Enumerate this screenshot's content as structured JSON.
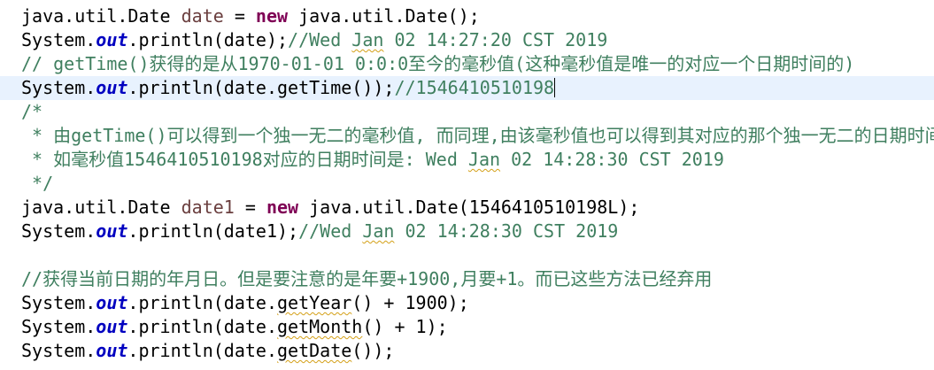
{
  "editor": {
    "current_line_color": "#e8f2fe",
    "colors": {
      "keyword": "#7f0055",
      "variable": "#6a3e3e",
      "static_field": "#0000c0",
      "comment": "#3f7f5f",
      "plain": "#000000"
    },
    "lines": [
      {
        "current": false,
        "tokens": [
          {
            "t": "java.util.Date ",
            "c": "plain"
          },
          {
            "t": "date",
            "c": "var"
          },
          {
            "t": " = ",
            "c": "plain"
          },
          {
            "t": "new",
            "c": "kw"
          },
          {
            "t": " java.util.Date();",
            "c": "plain"
          }
        ]
      },
      {
        "current": false,
        "tokens": [
          {
            "t": "System.",
            "c": "plain"
          },
          {
            "t": "out",
            "c": "static"
          },
          {
            "t": ".println(date);",
            "c": "plain"
          },
          {
            "t": "//Wed ",
            "c": "cmt"
          },
          {
            "t": "Jan",
            "c": "cmt squig"
          },
          {
            "t": " 02 14:27:20 CST 2019",
            "c": "cmt"
          }
        ]
      },
      {
        "current": false,
        "tokens": [
          {
            "t": "// getTime()获得的是从1970-01-01 0:0:0至今的毫秒值(这种毫秒值是唯一的对应一个日期时间的)",
            "c": "cmt"
          }
        ]
      },
      {
        "current": true,
        "tokens": [
          {
            "t": "System.",
            "c": "plain"
          },
          {
            "t": "out",
            "c": "static"
          },
          {
            "t": ".println(date.getTime());",
            "c": "plain"
          },
          {
            "t": "//1546410510198",
            "c": "cmt"
          }
        ],
        "caret": true
      },
      {
        "current": false,
        "tokens": [
          {
            "t": "/*",
            "c": "cmt"
          }
        ]
      },
      {
        "current": false,
        "tokens": [
          {
            "t": " * 由getTime()可以得到一个独一无二的毫秒值, 而同理,由该毫秒值也可以得到其对应的那个独一无二的日期时间",
            "c": "cmt"
          }
        ]
      },
      {
        "current": false,
        "tokens": [
          {
            "t": " * 如毫秒值1546410510198对应的日期时间是: Wed ",
            "c": "cmt"
          },
          {
            "t": "Jan",
            "c": "cmt squig"
          },
          {
            "t": " 02 14:28:30 CST 2019",
            "c": "cmt"
          }
        ]
      },
      {
        "current": false,
        "tokens": [
          {
            "t": " */",
            "c": "cmt"
          }
        ]
      },
      {
        "current": false,
        "tokens": [
          {
            "t": "java.util.Date ",
            "c": "plain"
          },
          {
            "t": "date1",
            "c": "var"
          },
          {
            "t": " = ",
            "c": "plain"
          },
          {
            "t": "new",
            "c": "kw"
          },
          {
            "t": " java.util.Date(1546410510198L);",
            "c": "plain"
          }
        ]
      },
      {
        "current": false,
        "tokens": [
          {
            "t": "System.",
            "c": "plain"
          },
          {
            "t": "out",
            "c": "static"
          },
          {
            "t": ".println(date1);",
            "c": "plain"
          },
          {
            "t": "//Wed ",
            "c": "cmt"
          },
          {
            "t": "Jan",
            "c": "cmt squig"
          },
          {
            "t": " 02 14:28:30 CST 2019",
            "c": "cmt"
          }
        ]
      },
      {
        "current": false,
        "tokens": [
          {
            "t": "",
            "c": "plain"
          }
        ]
      },
      {
        "current": false,
        "tokens": [
          {
            "t": "//获得当前日期的年月日。但是要注意的是年要+1900,月要+1。而已这些方法已经弃用",
            "c": "cmt"
          }
        ]
      },
      {
        "current": false,
        "tokens": [
          {
            "t": "System.",
            "c": "plain"
          },
          {
            "t": "out",
            "c": "static"
          },
          {
            "t": ".println(date.",
            "c": "plain"
          },
          {
            "t": "getYear",
            "c": "plain strike squig"
          },
          {
            "t": "() + 1900);",
            "c": "plain"
          }
        ]
      },
      {
        "current": false,
        "tokens": [
          {
            "t": "System.",
            "c": "plain"
          },
          {
            "t": "out",
            "c": "static"
          },
          {
            "t": ".println(date.",
            "c": "plain"
          },
          {
            "t": "getMonth",
            "c": "plain strike squig"
          },
          {
            "t": "() + 1);",
            "c": "plain"
          }
        ]
      },
      {
        "current": false,
        "tokens": [
          {
            "t": "System.",
            "c": "plain"
          },
          {
            "t": "out",
            "c": "static"
          },
          {
            "t": ".println(date.",
            "c": "plain"
          },
          {
            "t": "getDate",
            "c": "plain strike squig"
          },
          {
            "t": "());",
            "c": "plain"
          }
        ]
      }
    ]
  }
}
